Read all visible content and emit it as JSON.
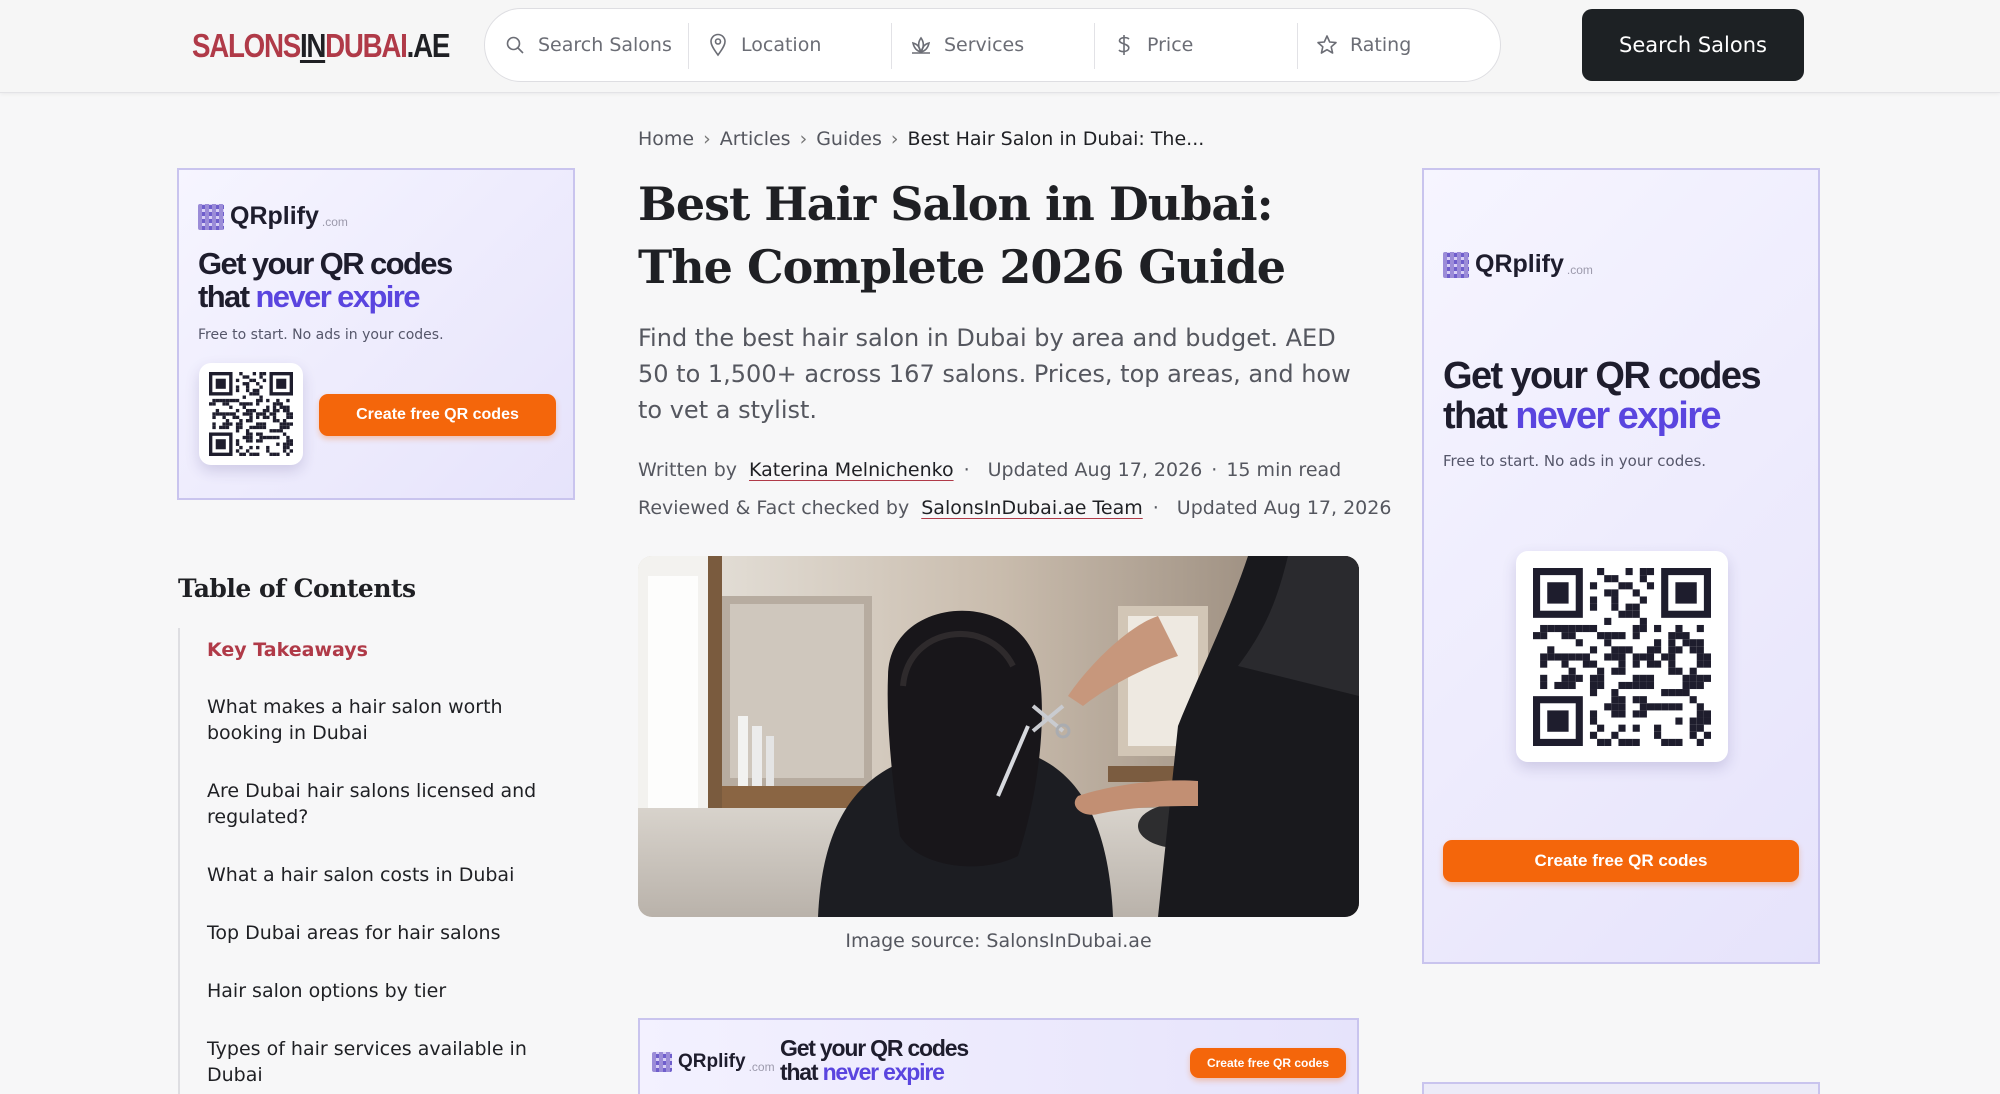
{
  "header": {
    "logo": {
      "part1": "SALONS",
      "part2": "IN",
      "part3": "DUBAI",
      "part4": ".AE"
    },
    "search_fields": [
      {
        "label": "Search Salons",
        "icon": "search-icon"
      },
      {
        "label": "Location",
        "icon": "location-pin-icon"
      },
      {
        "label": "Services",
        "icon": "lotus-icon"
      },
      {
        "label": "Price",
        "icon": "dollar-icon"
      },
      {
        "label": "Rating",
        "icon": "star-icon"
      }
    ],
    "search_button": "Search Salons"
  },
  "ad": {
    "brand": "QRplify",
    "brand_suffix": ".com",
    "headline_1": "Get your QR codes",
    "headline_2a": "that ",
    "headline_2b": "never expire",
    "subline": "Free to start. No ads in your codes.",
    "cta": "Create free QR codes"
  },
  "breadcrumb": {
    "items": [
      "Home",
      "Articles",
      "Guides"
    ],
    "current": "Best Hair Salon in Dubai: The..."
  },
  "article": {
    "title": "Best Hair Salon in Dubai: The Complete 2026 Guide",
    "lead": "Find the best hair salon in Dubai by area and budget. AED 50 to 1,500+ across 167 salons. Prices, top areas, and how to vet a stylist.",
    "author_label": "Written by",
    "author": "Katerina Melnichenko",
    "updated_1": "Updated Aug 17, 2026",
    "read_time": "15 min read",
    "reviewer_label": "Reviewed & Fact checked by",
    "reviewer": "SalonsInDubai.ae Team",
    "updated_2": "Updated Aug 17, 2026",
    "image_caption": "Image source: SalonsInDubai.ae"
  },
  "toc": {
    "title": "Table of Contents",
    "items": [
      "Key Takeaways",
      "What makes a hair salon worth booking in Dubai",
      "Are Dubai hair salons licensed and regulated?",
      "What a hair salon costs in Dubai",
      "Top Dubai areas for hair salons",
      "Hair salon options by tier",
      "Types of hair services available in Dubai"
    ],
    "active_index": 0
  },
  "colors": {
    "brand_red": "#b03a48",
    "dark": "#1d2124",
    "ad_accent": "#5a45df",
    "ad_cta": "#f4660b"
  }
}
